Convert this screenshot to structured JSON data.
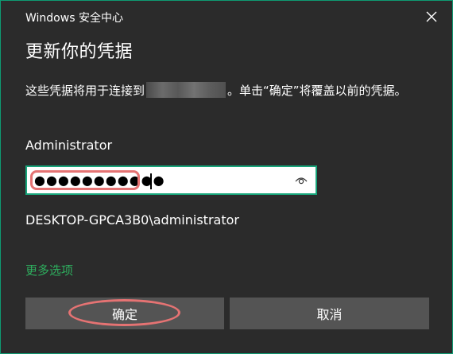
{
  "window": {
    "title": "Windows 安全中心",
    "close_icon": "close-icon"
  },
  "dialog": {
    "heading": "更新你的凭据",
    "message_before": "这些凭据将用于连接到",
    "message_after": "。单击“确定”将覆盖以前的凭据。",
    "username": "Administrator",
    "password_mask": "●●●●●●●●●●●",
    "reveal_icon": "eye-icon",
    "domain_user": "DESKTOP-GPCA3B0\\administrator",
    "more_options": "更多选项",
    "ok_label": "确定",
    "cancel_label": "取消"
  },
  "colors": {
    "background": "#2b2b2b",
    "accent_border": "#17a47a",
    "link": "#2eae5e",
    "button": "#545454",
    "annotation": "#e57373"
  }
}
